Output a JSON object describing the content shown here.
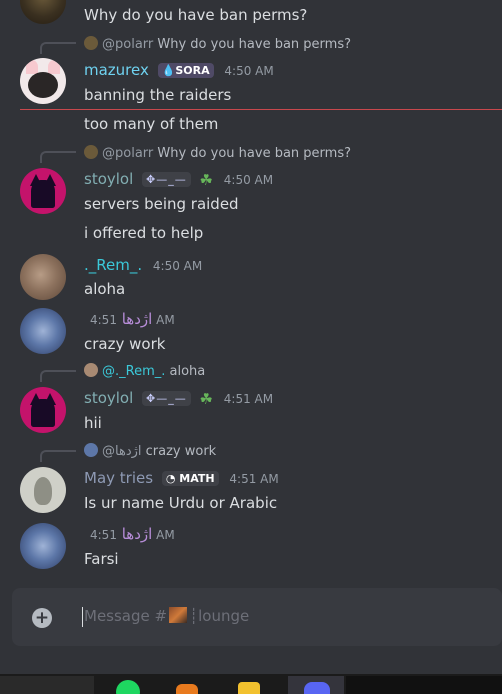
{
  "messages": [
    {
      "kind": "tail",
      "text": "Why do you have ban perms?"
    },
    {
      "reply": {
        "mention": "@polarr",
        "text": "Why do you have ban perms?"
      },
      "author": "mazurex",
      "author_color": "#6fd2f0",
      "badge": "SORA",
      "time": "4:50 AM",
      "lines": [
        "banning the raiders",
        "too many of them"
      ]
    },
    {
      "reply": {
        "mention": "@polarr",
        "text": "Why do you have ban perms?"
      },
      "author": "stoylol",
      "author_color": "#82aeb2",
      "badge": "✥—_—",
      "time": "4:50 AM",
      "lines": [
        "servers being raided",
        "i offered to help"
      ]
    },
    {
      "author": "._Rem_.",
      "author_color": "#3bc9d9",
      "time": "4:50 AM",
      "lines": [
        "aloha"
      ]
    },
    {
      "author": "اژدها",
      "author_color": "#b78dd8",
      "time": "4:51 AM",
      "lines": [
        "crazy work"
      ]
    },
    {
      "reply": {
        "mention": "@._Rem_.",
        "text": "aloha"
      },
      "author": "stoylol",
      "author_color": "#82aeb2",
      "badge": "✥—_—",
      "time": "4:51 AM",
      "lines": [
        "hii"
      ]
    },
    {
      "reply": {
        "mention": "@اژدها",
        "text": "crazy work"
      },
      "author": "May tries",
      "author_color": "#8e9ab4",
      "badge": "MATH",
      "time": "4:51 AM",
      "lines": [
        "Is ur name Urdu or Arabic"
      ]
    },
    {
      "author": "اژدها",
      "author_color": "#b78dd8",
      "time": "4:51 AM",
      "lines": [
        "Farsi"
      ]
    }
  ],
  "composer": {
    "placeholder_prefix": "Message #",
    "placeholder_channel": "┊lounge",
    "plus_label": "+"
  },
  "icons": {
    "plus": "plus-circle-icon",
    "clover": "clover-icon",
    "sora_badge": "drop-icon",
    "math_badge": "clock-icon"
  }
}
